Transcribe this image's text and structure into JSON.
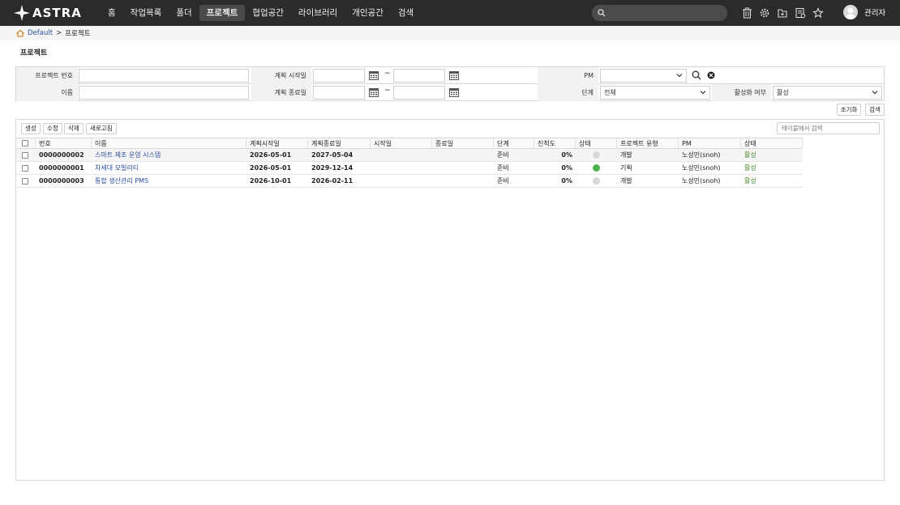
{
  "app": {
    "logo": "ASTRA"
  },
  "nav": [
    {
      "label": "홈",
      "active": false
    },
    {
      "label": "작업목록",
      "active": false
    },
    {
      "label": "폴더",
      "active": false
    },
    {
      "label": "프로젝트",
      "active": true
    },
    {
      "label": "협업공간",
      "active": false
    },
    {
      "label": "라이브러리",
      "active": false
    },
    {
      "label": "개인공간",
      "active": false
    },
    {
      "label": "검색",
      "active": false
    }
  ],
  "header": {
    "search_placeholder": "",
    "tools": [
      "trash-icon",
      "settings-icon",
      "add-file-icon",
      "report-icon",
      "star-icon"
    ],
    "user_name": "관리자"
  },
  "breadcrumb": {
    "home": "Default",
    "separator": ">",
    "current": "프로젝트"
  },
  "page_title": "프로젝트",
  "filter": {
    "project_no_label": "프로젝트 번호",
    "project_no_value": "",
    "name_label": "이름",
    "name_value": "",
    "plan_start_label": "계획 시작일",
    "plan_end_label": "계획 종료일",
    "range_sep": "~",
    "pm_label": "PM",
    "pm_value": "",
    "stage_label": "단계",
    "stage_value": "전체",
    "activation_label": "활성화 여부",
    "activation_value": "활성",
    "reset_label": "초기화",
    "search_label": "검색"
  },
  "grid": {
    "actions": {
      "create": "생성",
      "edit": "수정",
      "delete": "삭제",
      "refresh": "새로고침"
    },
    "search_placeholder": "테이블에서 검색",
    "columns": [
      "번호",
      "이름",
      "계획시작일",
      "계획종료일",
      "시작일",
      "종료일",
      "단계",
      "진척도",
      "상태",
      "프로젝트 유형",
      "PM",
      "상태"
    ],
    "rows": [
      {
        "no": "0000000002",
        "name": "스마트 제조 운영 시스템",
        "plan_start": "2026-05-01",
        "plan_end": "2027-05-04",
        "start": "",
        "end": "",
        "stage": "준비",
        "progress": "0%",
        "status_color": "#d8d8d8",
        "type": "개발",
        "pm": "노성민(snoh)",
        "state": "활성"
      },
      {
        "no": "0000000001",
        "name": "차세대 모빌리티",
        "plan_start": "2026-05-01",
        "plan_end": "2029-12-14",
        "start": "",
        "end": "",
        "stage": "준비",
        "progress": "0%",
        "status_color": "#4caf50",
        "type": "기획",
        "pm": "노성민(snoh)",
        "state": "활성"
      },
      {
        "no": "0000000003",
        "name": "통합 생산관리 PMS",
        "plan_start": "2026-10-01",
        "plan_end": "2026-02-11",
        "start": "",
        "end": "",
        "stage": "준비",
        "progress": "0%",
        "status_color": "#d8d8d8",
        "type": "개발",
        "pm": "노성민(snoh)",
        "state": "활성"
      }
    ]
  }
}
